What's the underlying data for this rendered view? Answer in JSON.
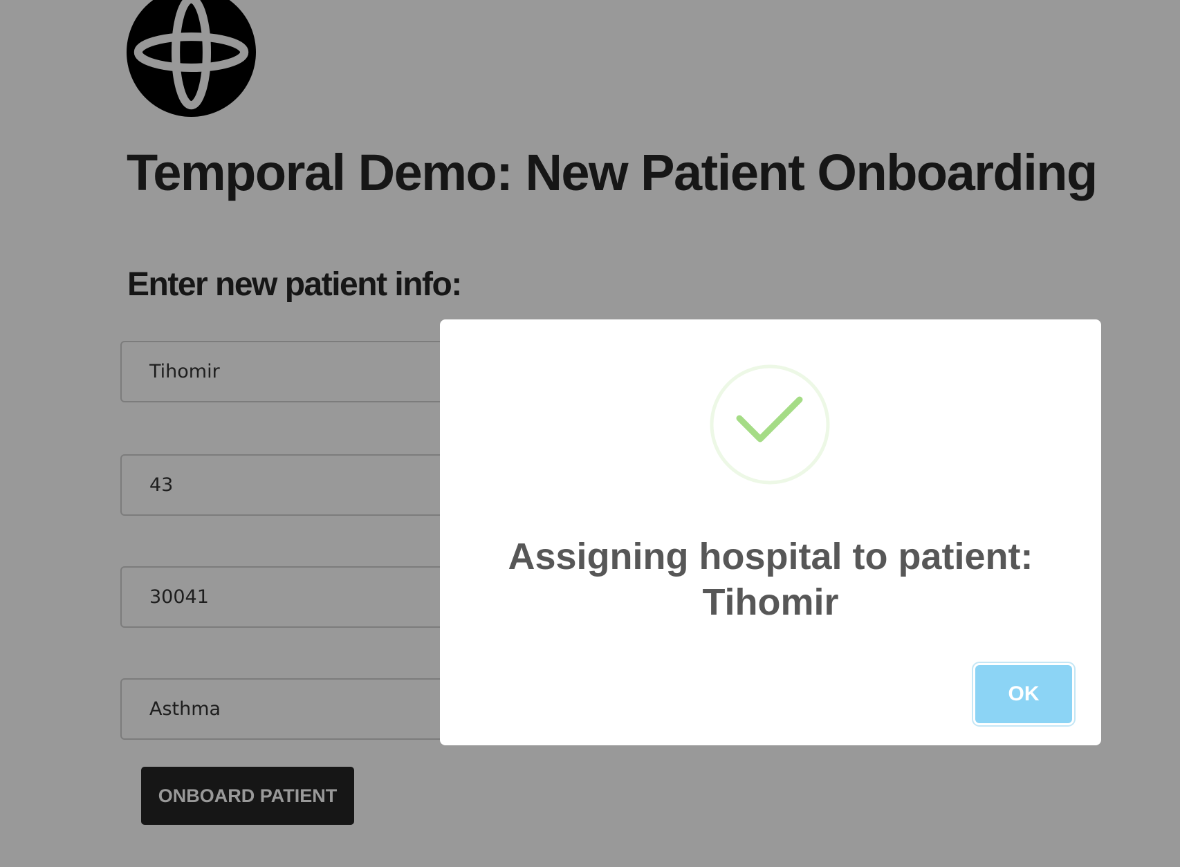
{
  "page": {
    "logo_icon": "temporal-logo-icon",
    "title": "Temporal Demo: New Patient Onboarding",
    "form_heading": "Enter new patient info:"
  },
  "form": {
    "first_name_value": "Tihomir",
    "age_value": "43",
    "zip_value": "30041",
    "condition_value": "Asthma",
    "submit_label": "ONBOARD PATIENT"
  },
  "modal": {
    "icon": "success-check-icon",
    "message_line1": "Assigning hospital to patient:",
    "message_line2": "Tihomir",
    "ok_label": "OK"
  },
  "colors": {
    "ok_button": "#8cd4f5",
    "success_check": "#a5dc86",
    "overlay": "rgba(0,0,0,0.4)",
    "submit_button": "#262626"
  }
}
